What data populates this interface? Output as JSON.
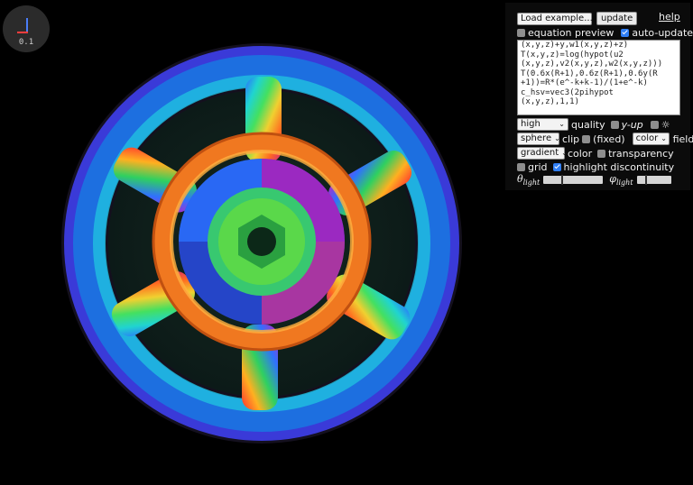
{
  "axes_widget": {
    "scale": "0.1"
  },
  "toolbar": {
    "example_select": "Load example...",
    "update_button": "update",
    "help_link": "help"
  },
  "options": {
    "equation_preview": {
      "label": "equation preview",
      "checked": false
    },
    "auto_update": {
      "label": "auto-update",
      "checked": true
    }
  },
  "editor": {
    "lines": [
      "(x,y,z)+y,w1(x,y,z)+z)",
      "T(x,y,z)=log(hypot(u2",
      "(x,y,z),v2(x,y,z),w2(x,y,z)))",
      "T(0.6x(R+1),0.6z(R+1),0.6y(R",
      "+1))=R*(e^-k+k-1)/(1+e^-k)",
      "c_hsv=vec3(2pihypot",
      "(x,y,z),1,1)"
    ]
  },
  "render": {
    "quality_select": "high",
    "quality_label": "quality",
    "y_up": {
      "label": "y-up",
      "checked": false
    },
    "light": {
      "checked": false,
      "icon": "sun-icon"
    },
    "clip_select": "sphere",
    "clip_label": "clip",
    "fixed": {
      "label": "(fixed)",
      "checked": false
    },
    "field_select": "color",
    "field_label": "field",
    "color_select": "gradient",
    "color_label": "color",
    "transparency": {
      "label": "transparency",
      "checked": false
    },
    "grid": {
      "label": "grid",
      "checked": false
    },
    "highlight_discontinuity": {
      "label": "highlight discontinuity",
      "checked": true
    }
  },
  "light_sliders": {
    "theta": {
      "symbol": "θ",
      "sub": "light",
      "value": 0.3
    },
    "phi": {
      "symbol": "φ",
      "sub": "light",
      "value": 0.25
    }
  },
  "colors": {
    "panel_bg": "#0b0b0b",
    "checkbox_on": "#2f7ef5",
    "axis_x": "#ff3d3d",
    "axis_y": "#4a7df7"
  }
}
